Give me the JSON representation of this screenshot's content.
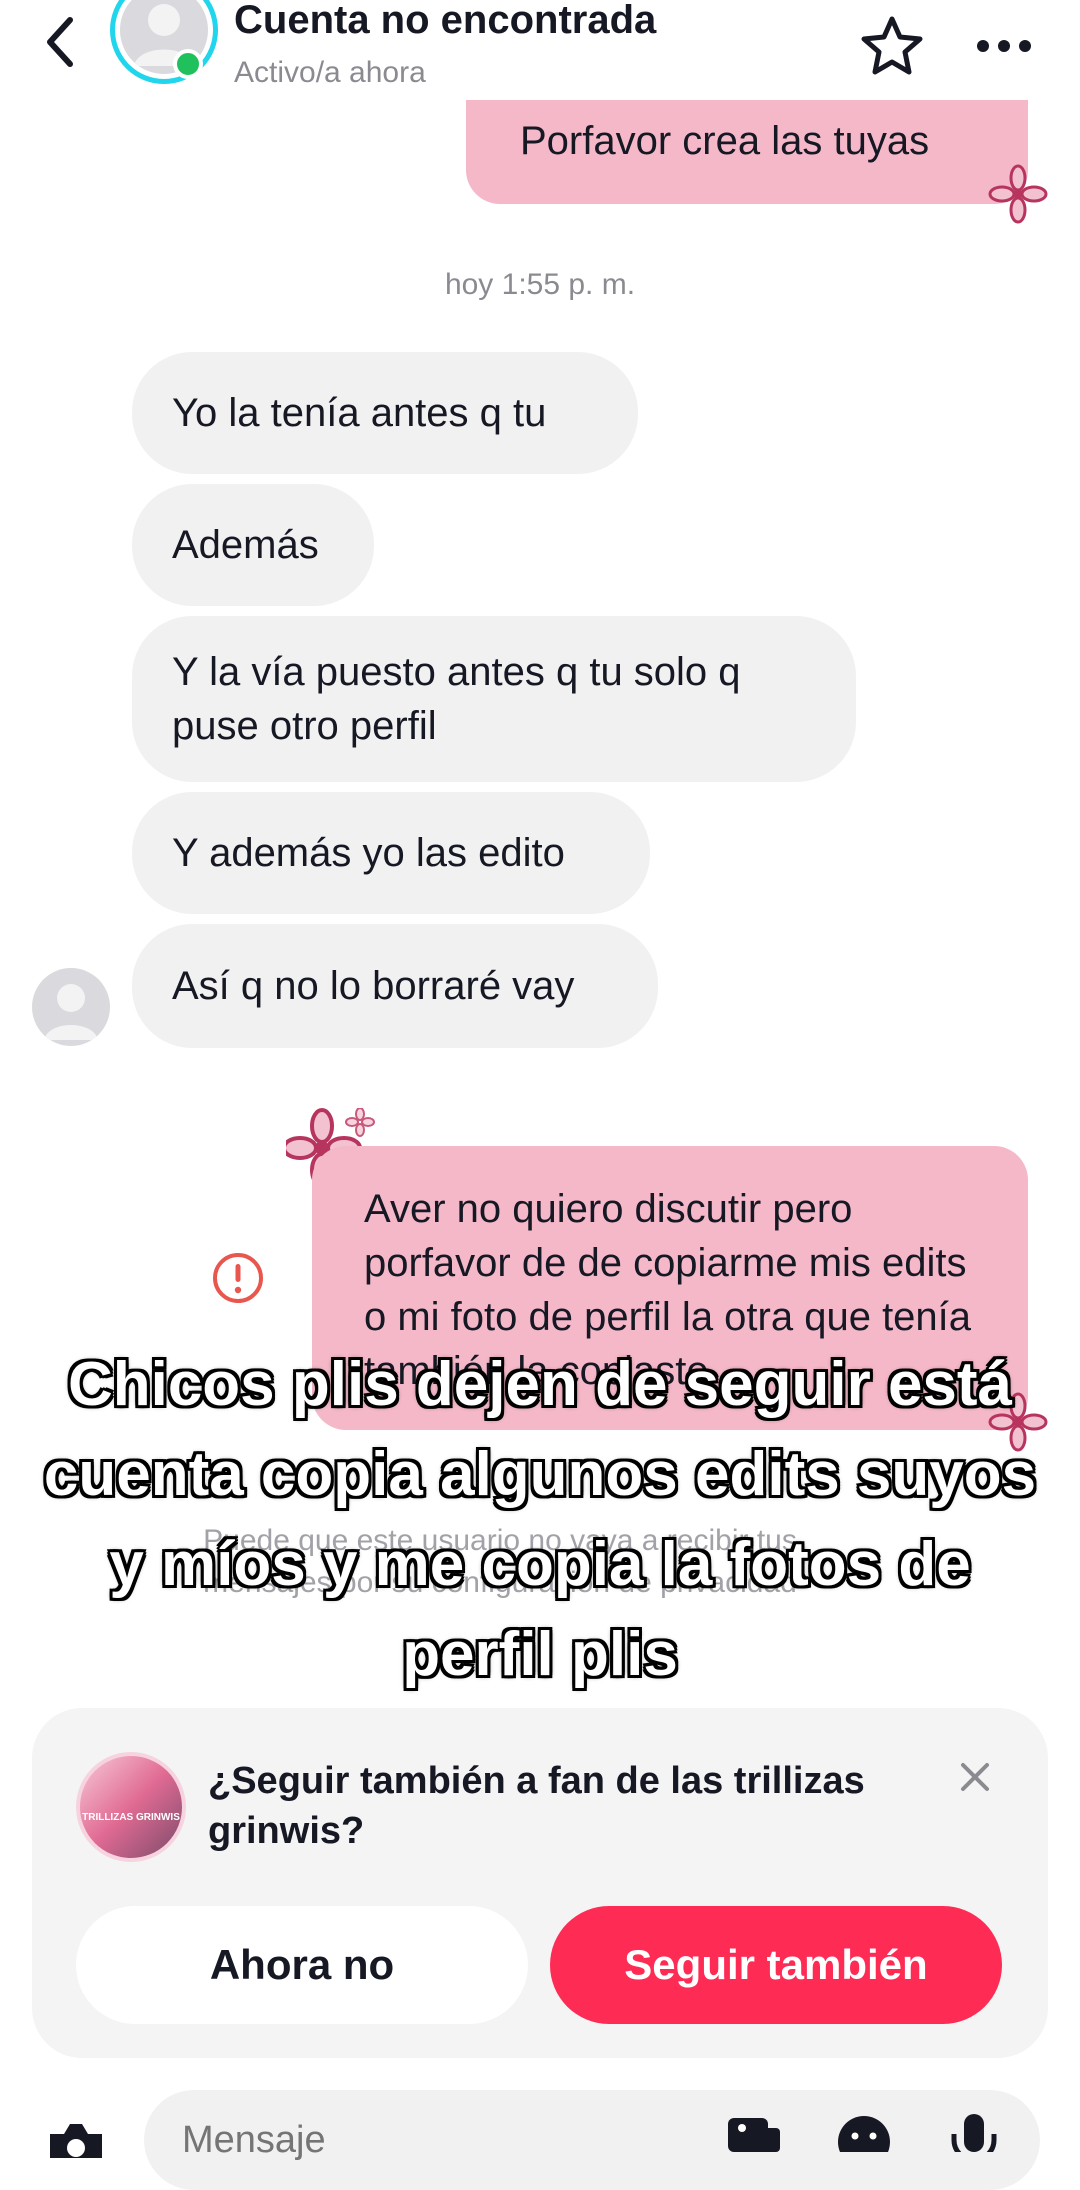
{
  "header": {
    "title": "Cuenta no encontrada",
    "status": "Activo/a ahora"
  },
  "messages": {
    "out_partial": "Porfavor crea las tuyas",
    "timestamp": "hoy 1:55 p. m.",
    "incoming": [
      "Yo la tenía antes q tu",
      "Además",
      "Y la vía puesto antes q tu solo q puse otro perfil",
      "Y además yo las edito",
      "Así q no lo borraré vay"
    ],
    "out_last": "Aver no quiero discutir pero porfavor de de copiarme mis edits o mi foto de perfil la otra que tenía también la copiaste"
  },
  "privacy_note": "Puede que este usuario no vaya a recibir tus mensajes por su configuración de privacidad",
  "caption": "Chicos plis dejen de seguir está cuenta copia algunos edits suyos y míos y me copia la fotos de perfil plis",
  "suggestion": {
    "text": "¿Seguir también a fan de las trillizas grinwis?",
    "avatar_text": "TRILLIZAS GRINWIS",
    "btn_later": "Ahora no",
    "btn_follow": "Seguir también"
  },
  "composer": {
    "placeholder": "Mensaje"
  },
  "colors": {
    "accent": "#fe2c55",
    "bubble_out": "#f4b8c8",
    "bubble_in": "#f1f1f2",
    "online": "#20c05c",
    "ring": "#20d5ec",
    "error": "#e8564d"
  },
  "icons": [
    "back-arrow-icon",
    "star-icon",
    "more-icon",
    "flower-icon",
    "error-icon",
    "close-icon",
    "camera-icon",
    "image-icon",
    "emoji-icon",
    "mic-icon"
  ]
}
